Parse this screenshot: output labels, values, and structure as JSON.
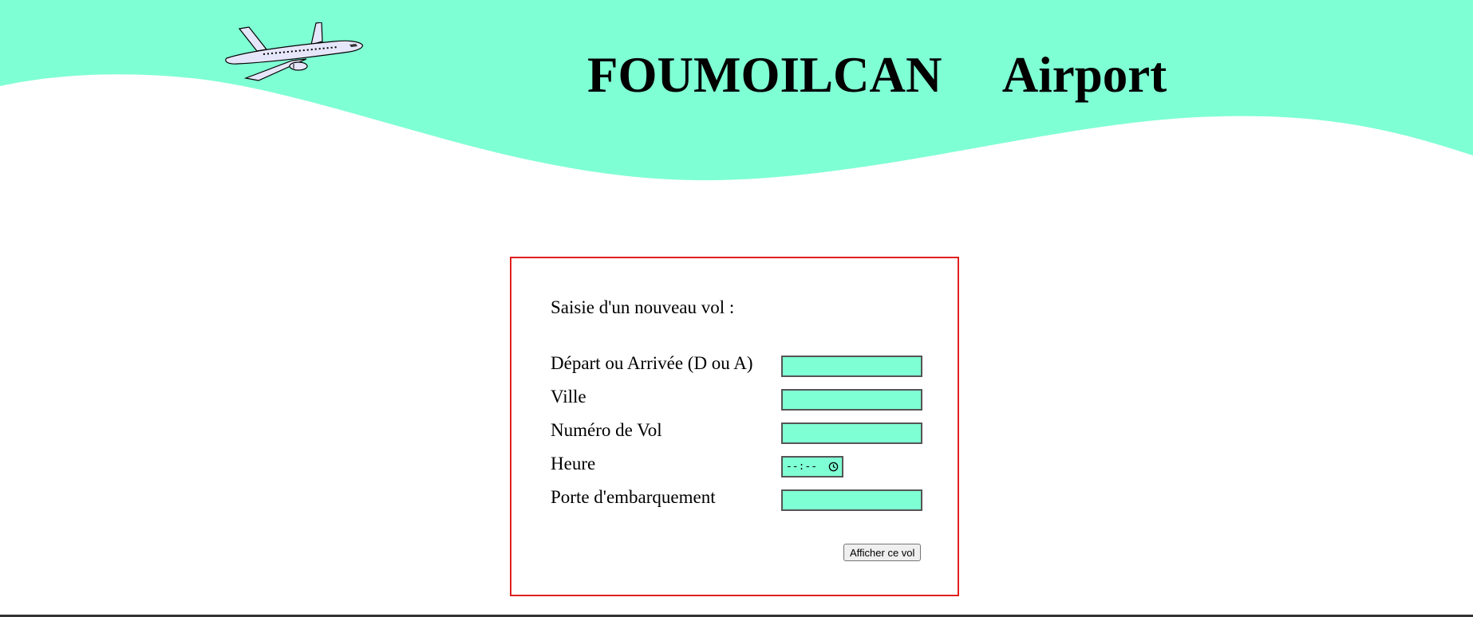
{
  "header": {
    "title": "FOUMOILCAN     Airport",
    "wave_color": "#7fffd4",
    "plane_icon": "airplane-icon"
  },
  "form": {
    "heading": "Saisie d'un nouveau vol :",
    "border_color": "#e02020",
    "field_color": "#7fffd4",
    "fields": [
      {
        "label": "Départ ou Arrivée (D ou A)",
        "value": ""
      },
      {
        "label": "Ville",
        "value": ""
      },
      {
        "label": "Numéro de Vol",
        "value": ""
      },
      {
        "label": "Heure",
        "value": "",
        "placeholder": "--:--"
      },
      {
        "label": "Porte d'embarquement",
        "value": ""
      }
    ],
    "submit_label": "Afficher ce vol"
  }
}
